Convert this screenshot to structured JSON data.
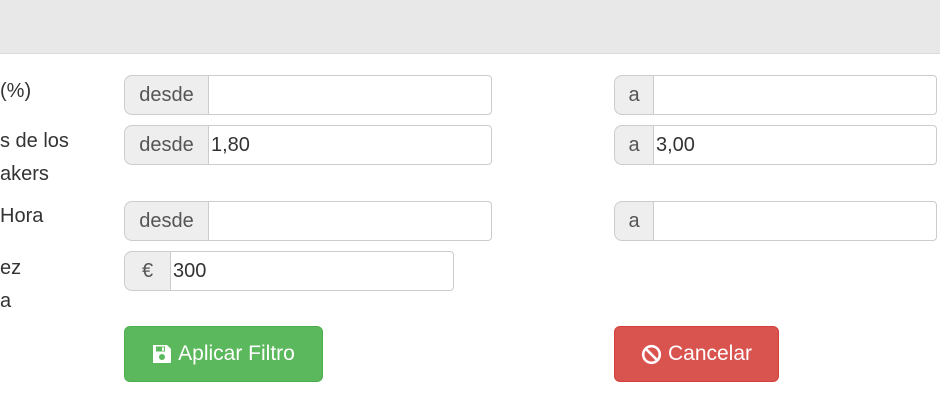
{
  "form": {
    "rows": [
      {
        "label": "(%)",
        "from": {
          "addon": "desde",
          "value": "",
          "placeholder": ""
        },
        "to": {
          "addon": "a",
          "value": "",
          "placeholder": ""
        }
      },
      {
        "label": "s de los\nakers",
        "from": {
          "addon": "desde",
          "value": "1,80",
          "placeholder": ""
        },
        "to": {
          "addon": "a",
          "value": "3,00",
          "placeholder": ""
        }
      },
      {
        "label": "Hora",
        "from": {
          "addon": "desde",
          "value": "",
          "placeholder": ""
        },
        "to": {
          "addon": "a",
          "value": "",
          "placeholder": ""
        }
      }
    ],
    "amount_row": {
      "label": "ez\na",
      "addon": "€",
      "value": "300",
      "placeholder": ""
    }
  },
  "buttons": {
    "apply": {
      "label": "Aplicar Filtro",
      "icon": "floppy-disk-icon",
      "color": "#5cb85c"
    },
    "cancel": {
      "label": "Cancelar",
      "icon": "ban-icon",
      "color": "#d9534f"
    }
  }
}
